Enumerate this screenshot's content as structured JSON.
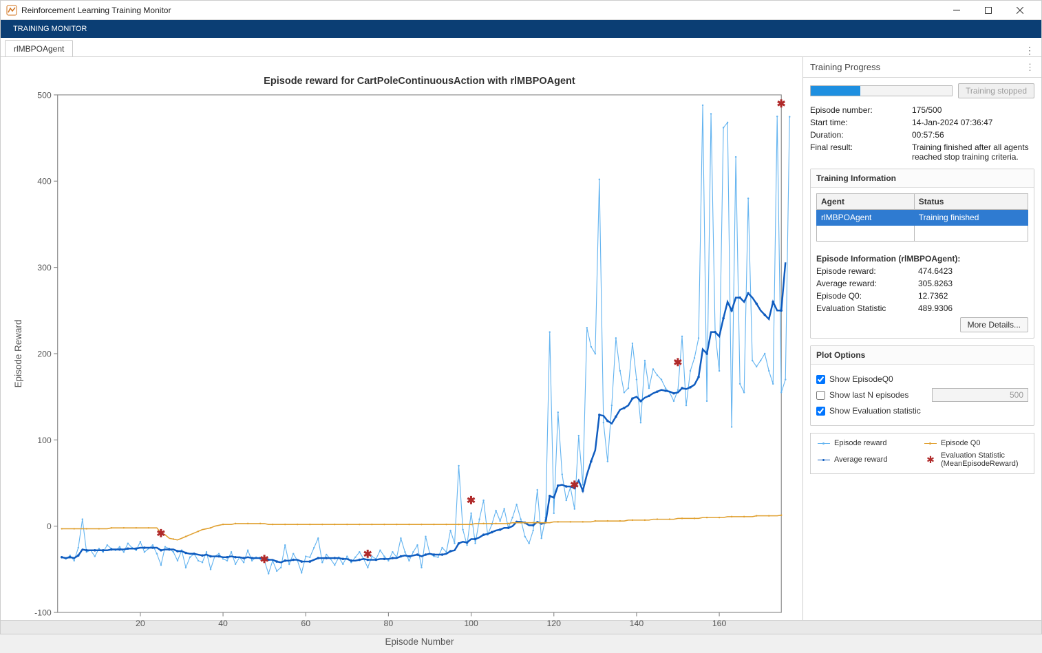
{
  "window": {
    "title": "Reinforcement Learning Training Monitor"
  },
  "ribbon": {
    "tab": "TRAINING MONITOR"
  },
  "docTab": {
    "label": "rlMBPOAgent"
  },
  "side": {
    "title": "Training Progress",
    "trainingStoppedBtn": "Training stopped",
    "episodeNumberLabel": "Episode number:",
    "episodeNumberValue": "175/500",
    "startTimeLabel": "Start time:",
    "startTimeValue": "14-Jan-2024 07:36:47",
    "durationLabel": "Duration:",
    "durationValue": "00:57:56",
    "finalResultLabel": "Final result:",
    "finalResultValue": "Training finished after all agents reached stop training criteria.",
    "trainingInfoTitle": "Training Information",
    "agentHeader": "Agent",
    "statusHeader": "Status",
    "agentName": "rlMBPOAgent",
    "agentStatus": "Training finished",
    "epInfoTitle": "Episode Information (rlMBPOAgent):",
    "epRewardLabel": "Episode reward:",
    "epRewardValue": "474.6423",
    "avgRewardLabel": "Average reward:",
    "avgRewardValue": "305.8263",
    "epQ0Label": "Episode Q0:",
    "epQ0Value": "12.7362",
    "evalStatLabel": "Evaluation Statistic",
    "evalStatValue": "489.9306",
    "moreDetailsBtn": "More Details...",
    "plotOptionsTitle": "Plot Options",
    "showQ0Label": "Show EpisodeQ0",
    "showLastNLabel": "Show last N episodes",
    "showLastNValue": "500",
    "showEvalLabel": "Show Evaluation statistic",
    "legend": {
      "episodeReward": "Episode reward",
      "averageReward": "Average reward",
      "episodeQ0": "Episode Q0",
      "evalStat": "Evaluation Statistic (MeanEpisodeReward)"
    }
  },
  "chart_data": {
    "type": "line",
    "title": "Episode reward for CartPoleContinuousAction with rlMBPOAgent",
    "xlabel": "Episode Number",
    "ylabel": "Episode Reward",
    "xlim": [
      0,
      175
    ],
    "ylim": [
      -100,
      500
    ],
    "xticks": [
      20,
      40,
      60,
      80,
      100,
      120,
      140,
      160
    ],
    "yticks": [
      -100,
      0,
      100,
      200,
      300,
      400,
      500
    ],
    "series": [
      {
        "name": "Episode reward",
        "color": "#64b4f0",
        "values": [
          -36,
          -38,
          -34,
          -40,
          -25,
          8,
          -30,
          -28,
          -35,
          -26,
          -30,
          -22,
          -26,
          -28,
          -24,
          -30,
          -20,
          -25,
          -28,
          -18,
          -30,
          -26,
          -22,
          -32,
          -45,
          -24,
          -26,
          -30,
          -40,
          -28,
          -48,
          -36,
          -32,
          -40,
          -42,
          -30,
          -50,
          -35,
          -32,
          -38,
          -40,
          -30,
          -44,
          -36,
          -42,
          -28,
          -40,
          -36,
          -38,
          -40,
          -55,
          -40,
          -52,
          -48,
          -22,
          -44,
          -32,
          -40,
          -54,
          -35,
          -36,
          -25,
          -14,
          -42,
          -33,
          -38,
          -45,
          -36,
          -44,
          -35,
          -42,
          -36,
          -30,
          -38,
          -48,
          -35,
          -38,
          -28,
          -35,
          -40,
          -30,
          -36,
          -14,
          -30,
          -40,
          -30,
          -22,
          -48,
          -12,
          -32,
          -35,
          -36,
          -25,
          -30,
          -5,
          -20,
          70,
          -4,
          -22,
          15,
          -20,
          8,
          30,
          -10,
          2,
          18,
          6,
          20,
          -2,
          10,
          25,
          8,
          -12,
          -20,
          -5,
          42,
          -14,
          10,
          225,
          15,
          132,
          60,
          30,
          45,
          20,
          105,
          48,
          230,
          208,
          200,
          402,
          120,
          75,
          140,
          218,
          180,
          155,
          160,
          212,
          170,
          120,
          192,
          160,
          182,
          175,
          170,
          160,
          155,
          145,
          158,
          220,
          140,
          180,
          195,
          218,
          488,
          145,
          478,
          225,
          180,
          462,
          468,
          115,
          428,
          165,
          155,
          380,
          192,
          185,
          192,
          200,
          180,
          165,
          475,
          155,
          170,
          474.64
        ]
      },
      {
        "name": "Average reward",
        "color": "#0f5cbf",
        "values": [
          -36,
          -37,
          -36,
          -37,
          -34,
          -27,
          -28,
          -28,
          -28,
          -28,
          -28,
          -28,
          -27,
          -27,
          -27,
          -27,
          -26,
          -26,
          -26,
          -25,
          -25,
          -25,
          -25,
          -25,
          -28,
          -27,
          -27,
          -27,
          -29,
          -29,
          -31,
          -32,
          -32,
          -33,
          -34,
          -33,
          -35,
          -35,
          -35,
          -36,
          -36,
          -35,
          -36,
          -36,
          -37,
          -36,
          -37,
          -37,
          -37,
          -37,
          -39,
          -39,
          -41,
          -42,
          -40,
          -40,
          -39,
          -39,
          -41,
          -41,
          -41,
          -39,
          -37,
          -37,
          -37,
          -37,
          -37,
          -37,
          -38,
          -38,
          -40,
          -40,
          -39,
          -38,
          -39,
          -39,
          -39,
          -38,
          -38,
          -38,
          -37,
          -37,
          -35,
          -34,
          -35,
          -34,
          -33,
          -35,
          -33,
          -32,
          -33,
          -33,
          -33,
          -32,
          -29,
          -28,
          -20,
          -18,
          -19,
          -15,
          -15,
          -13,
          -10,
          -9,
          -7,
          -5,
          -4,
          -2,
          -2,
          0,
          5,
          5,
          4,
          1,
          1,
          5,
          3,
          4,
          35,
          33,
          47,
          48,
          46,
          46,
          44,
          53,
          41,
          60,
          75,
          88,
          129,
          128,
          122,
          119,
          127,
          135,
          137,
          140,
          148,
          150,
          145,
          149,
          151,
          154,
          156,
          158,
          157,
          156,
          154,
          155,
          160,
          159,
          161,
          164,
          173,
          205,
          200,
          225,
          225,
          220,
          241,
          260,
          250,
          265,
          265,
          260,
          270,
          265,
          258,
          250,
          245,
          240,
          260,
          250,
          250,
          305.83
        ]
      },
      {
        "name": "Episode Q0",
        "color": "#e0a030",
        "values": [
          -3,
          -3,
          -3,
          -3,
          -3,
          -3,
          -3,
          -3,
          -3,
          -3,
          -3,
          -3,
          -2,
          -2,
          -2,
          -2,
          -2,
          -2,
          -2,
          -2,
          -2,
          -2,
          -2,
          -2,
          -8,
          -10,
          -14,
          -15,
          -16,
          -14,
          -12,
          -10,
          -8,
          -6,
          -4,
          -3,
          -2,
          0,
          1,
          2,
          2,
          2,
          3,
          3,
          3,
          3,
          3,
          3,
          3,
          3,
          2,
          2,
          2,
          2,
          2,
          2,
          2,
          2,
          2,
          2,
          2,
          2,
          2,
          2,
          2,
          2,
          2,
          2,
          2,
          2,
          2,
          2,
          2,
          2,
          2,
          2,
          2,
          2,
          2,
          2,
          2,
          2,
          2,
          2,
          2,
          2,
          2,
          2,
          2,
          2,
          2,
          2,
          2,
          2,
          2,
          2,
          2,
          2,
          2,
          2,
          3,
          3,
          3,
          3,
          3,
          3,
          3,
          3,
          3,
          4,
          4,
          4,
          4,
          4,
          4,
          4,
          4,
          4,
          4,
          5,
          5,
          5,
          5,
          5,
          5,
          5,
          5,
          5,
          5,
          6,
          6,
          6,
          6,
          6,
          6,
          6,
          6,
          7,
          7,
          7,
          7,
          7,
          7,
          8,
          8,
          8,
          8,
          8,
          8,
          9,
          9,
          9,
          9,
          9,
          9,
          10,
          10,
          10,
          10,
          10,
          10,
          11,
          11,
          11,
          11,
          11,
          11,
          11,
          12,
          12,
          12,
          12,
          12,
          12,
          12.74
        ]
      }
    ],
    "eval_points": [
      {
        "x": 25,
        "y": -8
      },
      {
        "x": 50,
        "y": -38
      },
      {
        "x": 75,
        "y": -32
      },
      {
        "x": 100,
        "y": 30
      },
      {
        "x": 125,
        "y": 48
      },
      {
        "x": 150,
        "y": 190
      },
      {
        "x": 175,
        "y": 489.93
      }
    ]
  }
}
